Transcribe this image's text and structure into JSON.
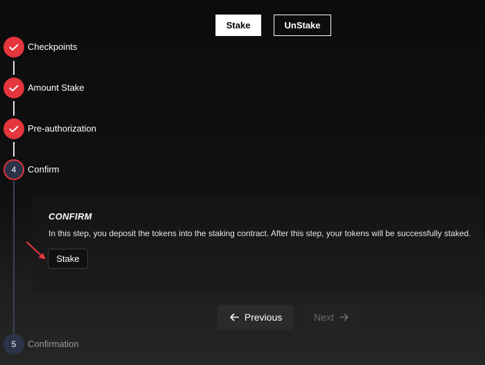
{
  "toggle": {
    "stake_label": "Stake",
    "unstake_label": "UnStake"
  },
  "steps": [
    {
      "label": "Checkpoints",
      "status": "completed"
    },
    {
      "label": "Amount Stake",
      "status": "completed"
    },
    {
      "label": "Pre-authorization",
      "status": "completed"
    },
    {
      "label": "Confirm",
      "status": "active",
      "number": "4"
    },
    {
      "label": "Confirmation",
      "status": "pending",
      "number": "5"
    }
  ],
  "confirm_card": {
    "title": "CONFIRM",
    "description": "In this step, you deposit the tokens into the staking contract. After this step, your tokens will be successfully staked.",
    "stake_button_label": "Stake"
  },
  "navigation": {
    "previous_label": "Previous",
    "next_label": "Next"
  },
  "colors": {
    "accent_red": "#e5353d",
    "step_pending_bg": "#2a3347",
    "background": "#111111"
  },
  "icons": {
    "completed_step": "check-icon",
    "previous": "arrow-left-icon",
    "next": "arrow-right-icon",
    "annotation": "red-arrow-icon"
  }
}
